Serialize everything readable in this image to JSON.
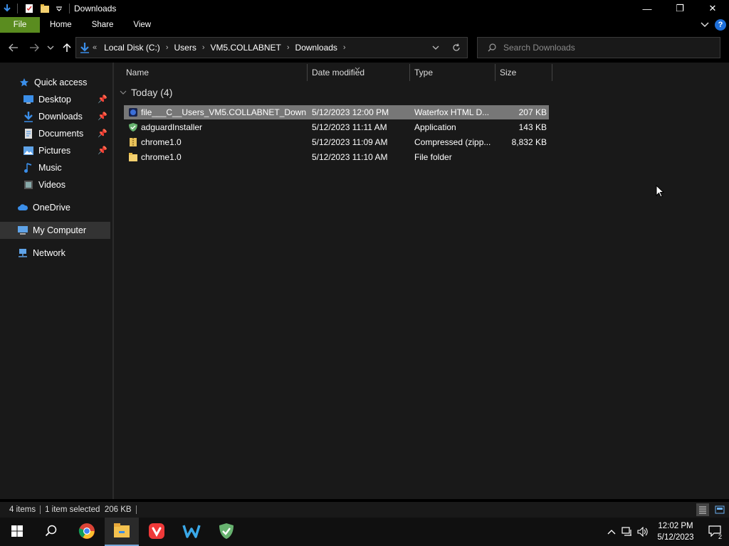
{
  "window": {
    "title": "Downloads",
    "minimize_glyph": "—",
    "maximize_glyph": "❐",
    "close_glyph": "✕"
  },
  "ribbon": {
    "tabs": [
      "File",
      "Home",
      "Share",
      "View"
    ]
  },
  "address": {
    "overflow": "«",
    "crumbs": [
      "Local Disk (C:)",
      "Users",
      "VM5.COLLABNET",
      "Downloads"
    ],
    "separator": "›"
  },
  "search": {
    "placeholder": "Search Downloads"
  },
  "sidebar": {
    "items": [
      {
        "label": "Quick access",
        "icon": "star-icon",
        "pinned": false
      },
      {
        "label": "Desktop",
        "icon": "desktop-icon",
        "pinned": true
      },
      {
        "label": "Downloads",
        "icon": "download-icon",
        "pinned": true
      },
      {
        "label": "Documents",
        "icon": "documents-icon",
        "pinned": true
      },
      {
        "label": "Pictures",
        "icon": "pictures-icon",
        "pinned": true
      },
      {
        "label": "Music",
        "icon": "music-icon",
        "pinned": false
      },
      {
        "label": "Videos",
        "icon": "videos-icon",
        "pinned": false
      },
      {
        "label": "OneDrive",
        "icon": "cloud-icon",
        "pinned": false
      },
      {
        "label": "My Computer",
        "icon": "computer-icon",
        "pinned": false,
        "selected": true
      },
      {
        "label": "Network",
        "icon": "network-icon",
        "pinned": false
      }
    ]
  },
  "columns": {
    "name": "Name",
    "date": "Date modified",
    "type": "Type",
    "size": "Size"
  },
  "group": {
    "label": "Today (4)"
  },
  "files": [
    {
      "name": "file___C__Users_VM5.COLLABNET_Down...",
      "date": "5/12/2023 12:00 PM",
      "type": "Waterfox HTML D...",
      "size": "207 KB",
      "icon": "waterfox-html-icon",
      "selected": true
    },
    {
      "name": "adguardInstaller",
      "date": "5/12/2023 11:11 AM",
      "type": "Application",
      "size": "143 KB",
      "icon": "adguard-icon",
      "selected": false
    },
    {
      "name": "chrome1.0",
      "date": "5/12/2023 11:09 AM",
      "type": "Compressed (zipp...",
      "size": "8,832 KB",
      "icon": "zip-folder-icon",
      "selected": false
    },
    {
      "name": "chrome1.0",
      "date": "5/12/2023 11:10 AM",
      "type": "File folder",
      "size": "",
      "icon": "folder-icon",
      "selected": false
    }
  ],
  "status": {
    "count": "4 items",
    "selection": "1 item selected  206 KB"
  },
  "taskbar": {
    "apps": [
      "windows-start-icon",
      "search-icon",
      "chrome-icon",
      "file-explorer-icon",
      "vivaldi-icon",
      "waterfox-icon",
      "adguard-icon"
    ],
    "time": "12:02 PM",
    "date": "5/12/2023",
    "notification_count": "2"
  },
  "colors": {
    "file_tab": "#5a8c1f",
    "selection": "#777777",
    "accent": "#1e6fd9"
  }
}
